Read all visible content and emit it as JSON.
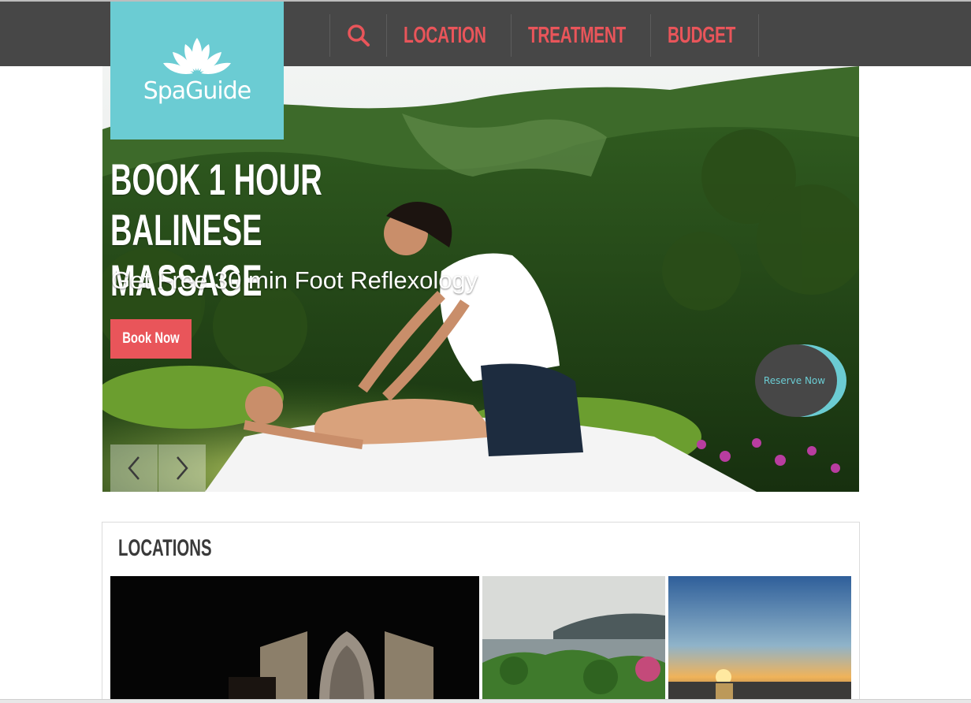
{
  "brand": {
    "name": "SpaGuide"
  },
  "nav": {
    "search_icon": "search-icon",
    "items": [
      {
        "label": "LOCATION"
      },
      {
        "label": "TREATMENT"
      },
      {
        "label": "BUDGET"
      }
    ]
  },
  "hero": {
    "headline_line1": "BOOK 1 HOUR BALINESE",
    "headline_line2": "MASSAGE",
    "subheadline": "Get Free 30 min Foot Reflexology",
    "book_button": "Book Now",
    "reserve_button": "Reserve Now"
  },
  "locations": {
    "title": "LOCATIONS"
  },
  "colors": {
    "accent": "#e9555a",
    "brand": "#6bccd3",
    "nav_bg": "#474747"
  }
}
